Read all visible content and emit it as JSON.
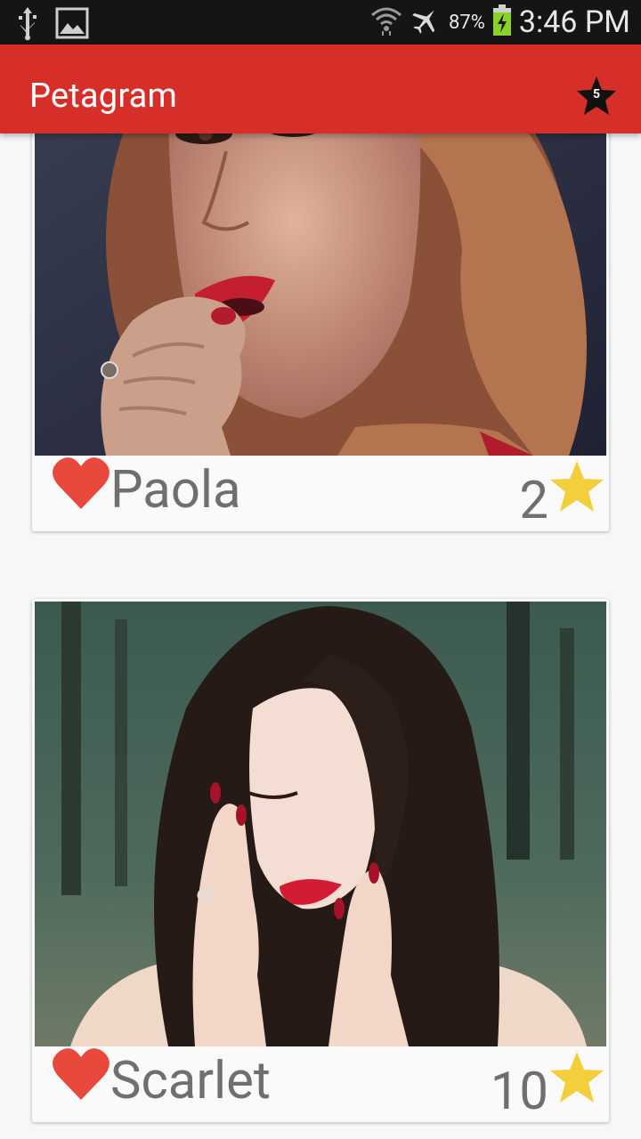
{
  "status_bar": {
    "battery_percent": "87%",
    "time": "3:46 PM",
    "icons": [
      "usb-icon",
      "image-notification-icon",
      "wifi-icon",
      "airplane-icon",
      "battery-charging-icon"
    ]
  },
  "app_bar": {
    "title": "Petagram",
    "favorites_count": "5",
    "background": "#d62f2a"
  },
  "pets": [
    {
      "name": "Paola",
      "rating": "2",
      "icons": [
        "heart-icon",
        "star-icon"
      ]
    },
    {
      "name": "Scarlet",
      "rating": "10",
      "icons": [
        "heart-icon",
        "star-icon"
      ]
    }
  ],
  "colors": {
    "heart": "#e8493c",
    "star": "#f3cf3d",
    "text": "#6f6f6f"
  }
}
